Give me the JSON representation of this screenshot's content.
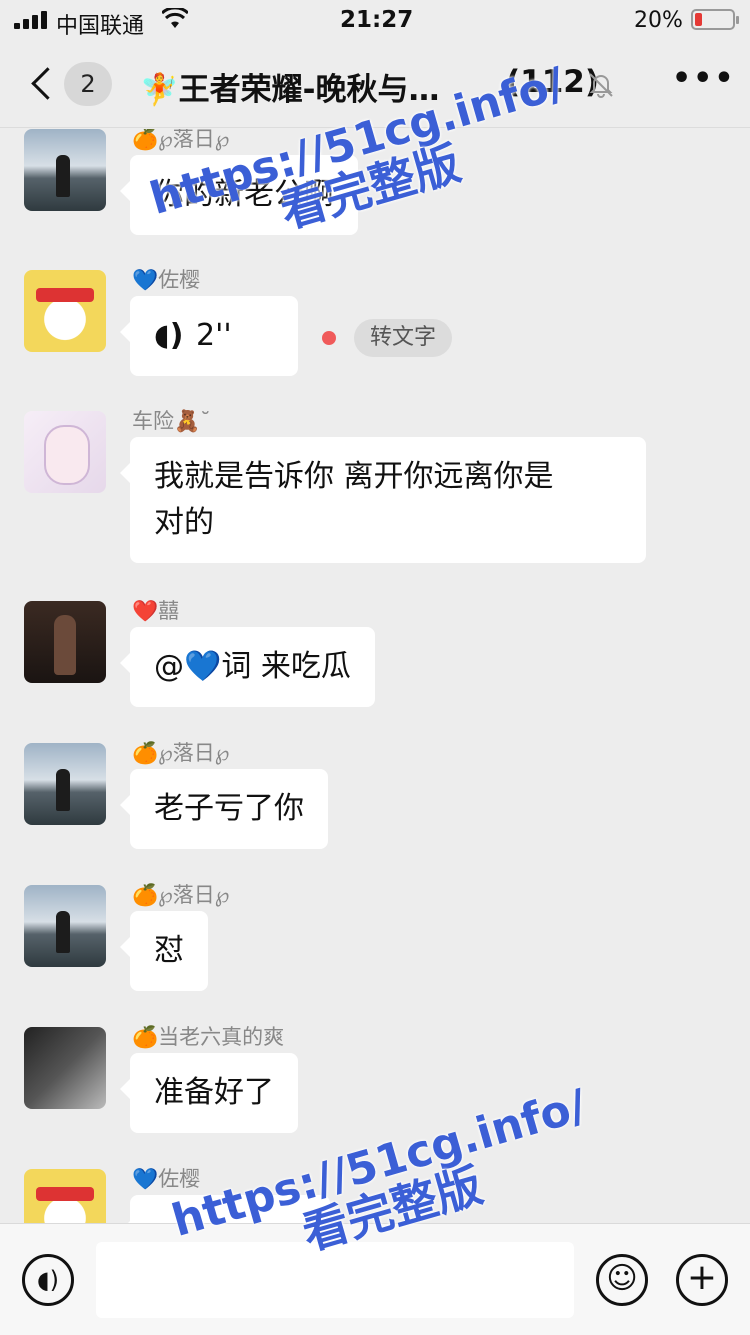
{
  "status_bar": {
    "carrier": "中国联通",
    "time": "21:27",
    "battery_pct": "20%"
  },
  "nav": {
    "badge": "2",
    "title": "🧚王者荣耀-晚秋与…",
    "count": "(112)"
  },
  "messages": [
    {
      "nick": "🍊℘落日℘",
      "text": "你的新老公啊"
    },
    {
      "nick": "💙佐樱",
      "voice": "2''",
      "to_text": "转文字"
    },
    {
      "nick": "车险🧸˘",
      "line1": "我就是告诉你  离开你远离你是",
      "line2": "对的"
    },
    {
      "nick": "❤️囍",
      "text": "@💙词 来吃瓜"
    },
    {
      "nick": "🍊℘落日℘",
      "text": "老子亏了你"
    },
    {
      "nick": "🍊℘落日℘",
      "text": "怼"
    },
    {
      "nick": "🍊当老六真的爽",
      "text": "准备好了"
    },
    {
      "nick": "💙佐樱",
      "text": ""
    }
  ],
  "input": {
    "value": ""
  },
  "watermark": {
    "url": "https://51cg.info/",
    "caption": "看完整版"
  },
  "colors": {
    "background": "#ededed",
    "bubble": "#ffffff",
    "watermark": "#3b5fd6",
    "unread_dot": "#f05a5a"
  }
}
